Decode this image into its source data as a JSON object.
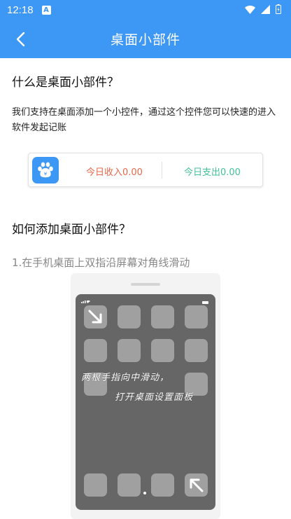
{
  "status_bar": {
    "time": "12:18",
    "app_icon": "A"
  },
  "app_bar": {
    "title": "桌面小部件",
    "back_icon": "chevron-left-icon"
  },
  "section1": {
    "heading": "什么是桌面小部件？",
    "description": "我们支持在桌面添加一个小控件，通过这个控件您可以快速的进入软件发起记账"
  },
  "widget": {
    "icon": "paw-yen-icon",
    "income_label": "今日收入0.00",
    "expense_label": "今日支出0.00",
    "colors": {
      "income": "#e8684a",
      "expense": "#43c29a",
      "brand": "#3d97f5"
    }
  },
  "section2": {
    "heading": "如何添加桌面小部件？",
    "step1": "1.在手机桌面上双指沿屏幕对角线滑动"
  },
  "demo": {
    "gesture_line1": "两根手指向中滑动，",
    "gesture_line2": "打开桌面设置面板"
  }
}
